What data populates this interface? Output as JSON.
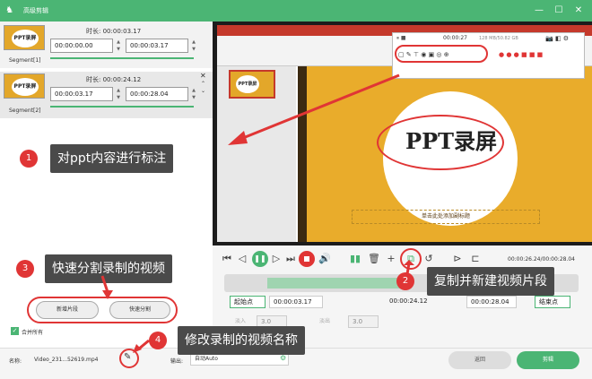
{
  "window": {
    "title": "高级剪辑"
  },
  "segments": [
    {
      "label": "Segment[1]",
      "duration_label": "时长:",
      "duration": "00:00:03.17",
      "start": "00:00:00.00",
      "end": "00:00:03.17",
      "thumb_text": "PPT录屏"
    },
    {
      "label": "Segment[2]",
      "duration_label": "时长:",
      "duration": "00:00:24.12",
      "start": "00:00:03.17",
      "end": "00:00:28.04",
      "thumb_text": "PPT录屏"
    }
  ],
  "left_buttons": {
    "add_segment": "新增片段",
    "quick_split": "快速分割"
  },
  "merge_all": "合并所有",
  "filename_label": "名称:",
  "filename": "Video_231...52619.mp4",
  "output_label": "输出:",
  "output_value": "自动Auto",
  "slide": {
    "title": "PPT录屏",
    "subtitle": "单击此处添加副标题",
    "thumb_text": "PPT录屏"
  },
  "annot_toolbar": {
    "time": "00:00:27",
    "info": "128 MB/50.82 GB"
  },
  "player": {
    "timecode": "00:00:26.24/00:00:28.04"
  },
  "range": {
    "start_btn": "起始点",
    "start": "00:00:03.17",
    "duration": "00:00:24.12",
    "end": "00:00:28.04",
    "end_btn": "结束点"
  },
  "fade": {
    "in_label": "淡入",
    "in_value": "3.0",
    "out_label": "淡出",
    "out_value": "3.0"
  },
  "buttons": {
    "back": "返回",
    "cut": "剪辑"
  },
  "callouts": [
    {
      "num": "1",
      "text": "对ppt内容进行标注"
    },
    {
      "num": "2",
      "text": "复制并新建视频片段"
    },
    {
      "num": "3",
      "text": "快速分割录制的视频"
    },
    {
      "num": "4",
      "text": "修改录制的视频名称"
    }
  ],
  "colors": {
    "accent": "#4bb574",
    "annotation": "#e03535"
  }
}
